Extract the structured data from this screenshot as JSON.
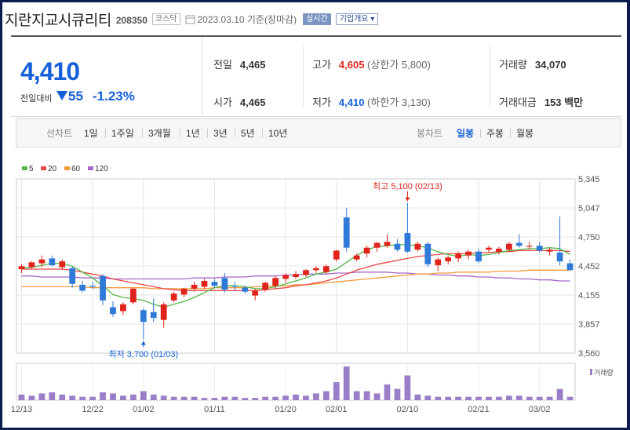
{
  "header": {
    "company_name": "지란지교시큐리티",
    "code": "208350",
    "market": "코스닥",
    "date_text": "2023.03.10 기준(장마감)",
    "realtime_label": "실시간",
    "company_info_label": "기업개요 ▾"
  },
  "price": {
    "current": "4,410",
    "change_label": "전일대비",
    "change_value": "55",
    "change_pct": "-1.23%"
  },
  "stats": {
    "prev_close_label": "전일",
    "prev_close": "4,465",
    "high_label": "고가",
    "high": "4,605",
    "upper_limit": "(상한가 5,800)",
    "volume_label": "거래량",
    "volume": "34,070",
    "open_label": "시가",
    "open": "4,465",
    "low_label": "저가",
    "low": "4,410",
    "lower_limit": "(하한가 3,130)",
    "amount_label": "거래대금",
    "amount": "153 백만"
  },
  "tabs": {
    "line_chart_label": "선차트",
    "periods": [
      "1일",
      "1주일",
      "3개월",
      "1년",
      "3년",
      "5년",
      "10년"
    ],
    "candle_chart_label": "봉차트",
    "candle_periods": [
      "일봉",
      "주봉",
      "월봉"
    ],
    "active_candle": "일봉"
  },
  "colors": {
    "up": "#e0241c",
    "down": "#2f7ad8",
    "ma5": "#52b848",
    "ma20": "#e84848",
    "ma60": "#f29a3c",
    "ma120": "#a668c8",
    "volume": "#9a7ec8"
  },
  "chart_data": {
    "type": "candlestick",
    "legend": [
      "5",
      "20",
      "60",
      "120"
    ],
    "y_ticks": [
      "5,345",
      "5,047",
      "4,750",
      "4,452",
      "4,155",
      "3,857",
      "3,560"
    ],
    "ylim": [
      3560,
      5345
    ],
    "x_ticks": [
      {
        "i": 0,
        "label": "12/13"
      },
      {
        "i": 7,
        "label": "12/22"
      },
      {
        "i": 12,
        "label": "01/02"
      },
      {
        "i": 19,
        "label": "01/11"
      },
      {
        "i": 26,
        "label": "01/20"
      },
      {
        "i": 31,
        "label": "02/01"
      },
      {
        "i": 38,
        "label": "02/10"
      },
      {
        "i": 45,
        "label": "02/21"
      },
      {
        "i": 51,
        "label": "03/02"
      }
    ],
    "annotations": {
      "max_label": "최고 5,100 (02/13)",
      "min_label": "최저 3,700 (01/03)"
    },
    "volume_label": "거래량",
    "candles": [
      [
        4420,
        4470,
        4380,
        4450
      ],
      [
        4440,
        4500,
        4420,
        4490
      ],
      [
        4480,
        4560,
        4440,
        4520
      ],
      [
        4530,
        4560,
        4450,
        4460
      ],
      [
        4440,
        4520,
        4410,
        4500
      ],
      [
        4430,
        4450,
        4230,
        4270
      ],
      [
        4260,
        4300,
        4180,
        4200
      ],
      [
        4250,
        4290,
        4220,
        4240
      ],
      [
        4350,
        4370,
        4050,
        4100
      ],
      [
        4030,
        4090,
        3930,
        3960
      ],
      [
        3990,
        4080,
        3950,
        4060
      ],
      [
        4080,
        4230,
        4060,
        4220
      ],
      [
        4000,
        4020,
        3700,
        3880
      ],
      [
        3980,
        4120,
        3880,
        3920
      ],
      [
        3900,
        4080,
        3820,
        4060
      ],
      [
        4100,
        4190,
        4080,
        4170
      ],
      [
        4160,
        4230,
        4130,
        4220
      ],
      [
        4220,
        4290,
        4190,
        4260
      ],
      [
        4240,
        4320,
        4220,
        4300
      ],
      [
        4290,
        4320,
        4230,
        4250
      ],
      [
        4330,
        4380,
        4180,
        4210
      ],
      [
        4250,
        4290,
        4200,
        4240
      ],
      [
        4230,
        4250,
        4170,
        4190
      ],
      [
        4150,
        4220,
        4100,
        4200
      ],
      [
        4210,
        4290,
        4190,
        4280
      ],
      [
        4250,
        4350,
        4220,
        4330
      ],
      [
        4320,
        4380,
        4280,
        4360
      ],
      [
        4340,
        4400,
        4320,
        4370
      ],
      [
        4360,
        4420,
        4340,
        4410
      ],
      [
        4410,
        4450,
        4380,
        4430
      ],
      [
        4390,
        4470,
        4370,
        4450
      ],
      [
        4520,
        4620,
        4500,
        4610
      ],
      [
        4950,
        5050,
        4600,
        4640
      ],
      [
        4520,
        4580,
        4500,
        4560
      ],
      [
        4580,
        4660,
        4540,
        4640
      ],
      [
        4640,
        4700,
        4600,
        4690
      ],
      [
        4660,
        4780,
        4640,
        4700
      ],
      [
        4680,
        4730,
        4600,
        4620
      ],
      [
        4790,
        5100,
        4590,
        4600
      ],
      [
        4620,
        4700,
        4600,
        4680
      ],
      [
        4680,
        4700,
        4440,
        4470
      ],
      [
        4460,
        4540,
        4400,
        4520
      ],
      [
        4500,
        4560,
        4470,
        4540
      ],
      [
        4530,
        4600,
        4490,
        4580
      ],
      [
        4560,
        4620,
        4520,
        4600
      ],
      [
        4600,
        4630,
        4480,
        4500
      ],
      [
        4620,
        4660,
        4590,
        4640
      ],
      [
        4600,
        4650,
        4570,
        4630
      ],
      [
        4620,
        4700,
        4600,
        4680
      ],
      [
        4690,
        4780,
        4640,
        4660
      ],
      [
        4650,
        4700,
        4620,
        4660
      ],
      [
        4660,
        4700,
        4590,
        4610
      ],
      [
        4600,
        4640,
        4560,
        4620
      ],
      [
        4590,
        4960,
        4460,
        4500
      ],
      [
        4480,
        4520,
        4410,
        4410
      ]
    ],
    "ma": {
      "ma5": [
        4430,
        4440,
        4460,
        4480,
        4480,
        4450,
        4390,
        4330,
        4250,
        4160,
        4130,
        4120,
        4100,
        4060,
        4030,
        4060,
        4090,
        4130,
        4180,
        4230,
        4250,
        4250,
        4240,
        4220,
        4220,
        4240,
        4270,
        4300,
        4330,
        4370,
        4390,
        4420,
        4490,
        4560,
        4620,
        4650,
        4660,
        4670,
        4670,
        4660,
        4640,
        4600,
        4570,
        4550,
        4570,
        4560,
        4570,
        4590,
        4610,
        4620,
        4630,
        4630,
        4640,
        4630,
        4570
      ],
      "ma20": [
        4420,
        4420,
        4420,
        4420,
        4420,
        4410,
        4390,
        4370,
        4350,
        4320,
        4300,
        4280,
        4260,
        4240,
        4220,
        4210,
        4200,
        4200,
        4200,
        4200,
        4200,
        4200,
        4200,
        4200,
        4210,
        4220,
        4230,
        4250,
        4260,
        4280,
        4300,
        4330,
        4370,
        4410,
        4440,
        4470,
        4490,
        4510,
        4530,
        4550,
        4560,
        4570,
        4580,
        4580,
        4580,
        4590,
        4590,
        4600,
        4600,
        4610,
        4610,
        4610,
        4610,
        4610,
        4600
      ],
      "ma60": [
        4240,
        4240,
        4240,
        4240,
        4240,
        4240,
        4240,
        4230,
        4230,
        4230,
        4230,
        4230,
        4230,
        4220,
        4220,
        4220,
        4220,
        4220,
        4220,
        4230,
        4230,
        4230,
        4230,
        4240,
        4240,
        4250,
        4250,
        4260,
        4260,
        4270,
        4280,
        4290,
        4300,
        4310,
        4320,
        4330,
        4340,
        4350,
        4360,
        4370,
        4370,
        4380,
        4380,
        4390,
        4390,
        4390,
        4390,
        4400,
        4400,
        4400,
        4410,
        4410,
        4410,
        4410,
        4410
      ],
      "ma120": [
        4350,
        4350,
        4340,
        4340,
        4340,
        4340,
        4330,
        4330,
        4330,
        4320,
        4320,
        4320,
        4320,
        4320,
        4320,
        4320,
        4320,
        4330,
        4330,
        4330,
        4340,
        4340,
        4340,
        4350,
        4350,
        4350,
        4360,
        4360,
        4370,
        4370,
        4370,
        4380,
        4380,
        4390,
        4390,
        4390,
        4390,
        4380,
        4380,
        4370,
        4370,
        4360,
        4360,
        4350,
        4350,
        4340,
        4340,
        4330,
        4330,
        4320,
        4320,
        4310,
        4310,
        4300,
        4300
      ]
    },
    "volumes": [
      5,
      4,
      6,
      7,
      5,
      4,
      3,
      3,
      7,
      6,
      4,
      5,
      8,
      5,
      4,
      3,
      3,
      3,
      2,
      2,
      3,
      3,
      2,
      2,
      3,
      3,
      4,
      5,
      4,
      6,
      8,
      16,
      30,
      8,
      8,
      6,
      14,
      10,
      22,
      5,
      4,
      3,
      3,
      3,
      3,
      3,
      3,
      3,
      4,
      4,
      3,
      3,
      3,
      10,
      3
    ]
  }
}
